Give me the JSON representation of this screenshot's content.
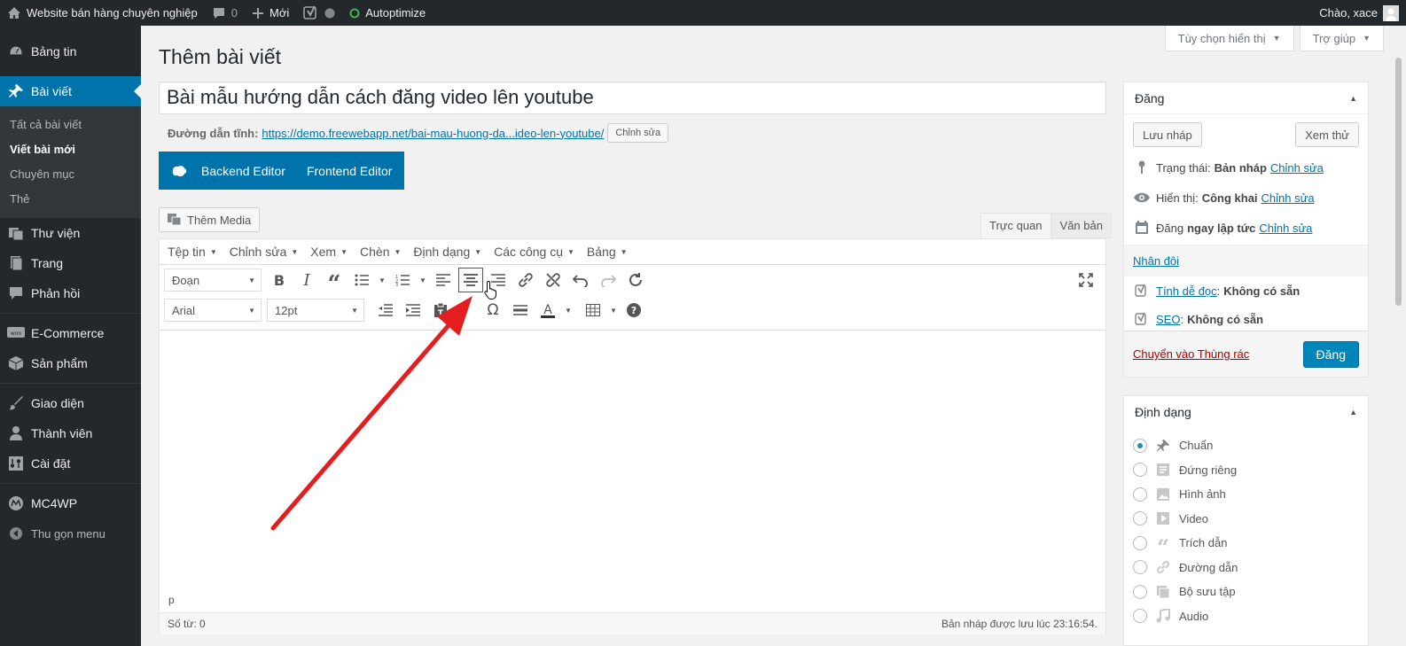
{
  "adminbar": {
    "site_name": "Website bán hàng chuyên nghiệp",
    "comments": "0",
    "new": "Mới",
    "autoptimize": "Autoptimize",
    "greeting": "Chào, xace"
  },
  "sidebar": {
    "items": [
      {
        "label": "Bảng tin"
      },
      {
        "label": "Bài viết"
      },
      {
        "label": "Thư viện"
      },
      {
        "label": "Trang"
      },
      {
        "label": "Phản hồi"
      },
      {
        "label": "E-Commerce"
      },
      {
        "label": "Sản phẩm"
      },
      {
        "label": "Giao diện"
      },
      {
        "label": "Thành viên"
      },
      {
        "label": "Cài đặt"
      },
      {
        "label": "MC4WP"
      },
      {
        "label": "Thu gọn menu"
      }
    ],
    "submenu": [
      "Tất cả bài viết",
      "Viết bài mới",
      "Chuyên mục",
      "Thẻ"
    ]
  },
  "screen_options": "Tùy chọn hiển thị",
  "help": "Trợ giúp",
  "page_title": "Thêm bài viết",
  "post_title": "Bài mẫu hướng dẫn cách đăng video lên youtube",
  "permalink": {
    "label": "Đường dẫn tĩnh:",
    "url": "https://demo.freewebapp.net/bai-mau-huong-da...ideo-len-youtube/",
    "edit": "Chỉnh sửa"
  },
  "vc": {
    "backend": "Backend Editor",
    "frontend": "Frontend Editor"
  },
  "add_media": "Thêm Media",
  "editor_tabs": [
    "Trực quan",
    "Văn bản"
  ],
  "menubar": [
    "Tệp tin",
    "Chỉnh sửa",
    "Xem",
    "Chèn",
    "Định dạng",
    "Các công cụ",
    "Bảng"
  ],
  "format_select": "Đoạn",
  "font_select": "Arial",
  "size_select": "12pt",
  "path": "p",
  "word_count": "Số từ: 0",
  "saved": "Bản nháp được lưu lúc 23:16:54.",
  "publish": {
    "title": "Đăng",
    "save_draft": "Lưu nháp",
    "preview": "Xem thử",
    "status_label": "Trạng thái:",
    "status_value": "Bản nháp",
    "visibility_label": "Hiển thị:",
    "visibility_value": "Công khai",
    "schedule_label": "Đăng",
    "schedule_value": "ngay lập tức",
    "edit": "Chỉnh sửa",
    "duplicate": "Nhân đôi",
    "readability_label": "Tính dễ đọc",
    "readability_value": "Không có sẵn",
    "seo_label": "SEO",
    "seo_value": "Không có sẵn",
    "trash": "Chuyển vào Thùng rác",
    "publish_btn": "Đăng"
  },
  "formats": {
    "title": "Định dạng",
    "options": [
      "Chuẩn",
      "Đứng riêng",
      "Hình ảnh",
      "Video",
      "Trích dẫn",
      "Đường dẫn",
      "Bộ sưu tập",
      "Audio"
    ],
    "selected": "Chuẩn"
  },
  "colors": {
    "accent": "#0073aa",
    "adminbar": "#23282d",
    "arrow": "#e41e1e",
    "trash": "#a00"
  }
}
